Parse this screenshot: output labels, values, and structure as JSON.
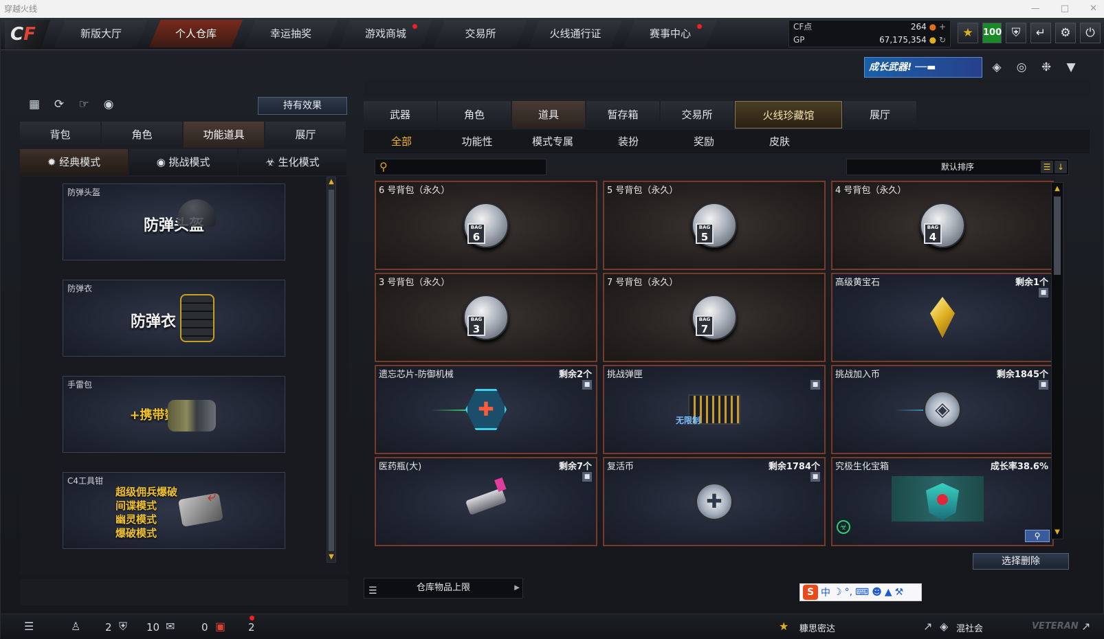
{
  "window": {
    "title": "穿越火线"
  },
  "nav": {
    "tabs": [
      "新版大厅",
      "个人仓库",
      "幸运抽奖",
      "游戏商城",
      "交易所",
      "火线通行证",
      "赛事中心"
    ]
  },
  "currency": {
    "cf_label": "CF点",
    "cf_value": "264",
    "gp_label": "GP",
    "gp_value": "67,175,354",
    "level": "100"
  },
  "banner": {
    "text": "成长武器!"
  },
  "left": {
    "effect_button": "持有效果",
    "tabs": [
      "背包",
      "角色",
      "功能道具",
      "展厅"
    ],
    "modes": [
      "经典模式",
      "挑战模式",
      "生化模式"
    ],
    "cards": [
      {
        "title": "防弹头盔",
        "big": "防弹头盔"
      },
      {
        "title": "防弹衣",
        "big": "防弹衣"
      },
      {
        "title": "手雷包",
        "big": "+携带数"
      },
      {
        "title": "C4工具钳",
        "lines": [
          "超级佣兵爆破",
          "间谍模式",
          "幽灵模式",
          "爆破模式"
        ]
      }
    ]
  },
  "right": {
    "tabs": [
      "武器",
      "角色",
      "道具",
      "暂存箱",
      "交易所",
      "火线珍藏馆",
      "展厅"
    ],
    "subtabs": [
      "全部",
      "功能性",
      "模式专属",
      "装扮",
      "奖励",
      "皮肤"
    ],
    "search_placeholder": "",
    "sort_label": "默认排序",
    "items": [
      {
        "name": "6 号背包（永久）",
        "rem": "",
        "num": "6"
      },
      {
        "name": "5 号背包（永久）",
        "rem": "",
        "num": "5"
      },
      {
        "name": "4 号背包（永久）",
        "rem": "",
        "num": "4"
      },
      {
        "name": "3 号背包（永久）",
        "rem": "",
        "num": "3"
      },
      {
        "name": "7 号背包（永久）",
        "rem": "",
        "num": "7"
      },
      {
        "name": "高级黄宝石",
        "rem": "剩余1个"
      },
      {
        "name": "遗忘芯片-防御机械",
        "rem": "剩余2个"
      },
      {
        "name": "挑战弹匣",
        "rem": "",
        "ammo_text": "无限制"
      },
      {
        "name": "挑战加入币",
        "rem": "剩余1845个"
      },
      {
        "name": "医药瓶(大)",
        "rem": "剩余7个"
      },
      {
        "name": "复活币",
        "rem": "剩余1784个"
      },
      {
        "name": "究极生化宝箱",
        "rem": "成长率38.6%"
      }
    ],
    "bag_label": "BAG",
    "delete_button": "选择删除",
    "capacity_label": "仓库物品上限"
  },
  "ime": {
    "lang": "中"
  },
  "statusbar": {
    "friends": "2",
    "clan": "10",
    "chat": "0",
    "gift": "2",
    "user1": "糠思密达",
    "user2": "混社会",
    "veteran": "VETERAN"
  },
  "colors": {
    "accent": "#f1b52a",
    "red_border": "#7a3a26",
    "active_tab": "#7a2a1c"
  }
}
